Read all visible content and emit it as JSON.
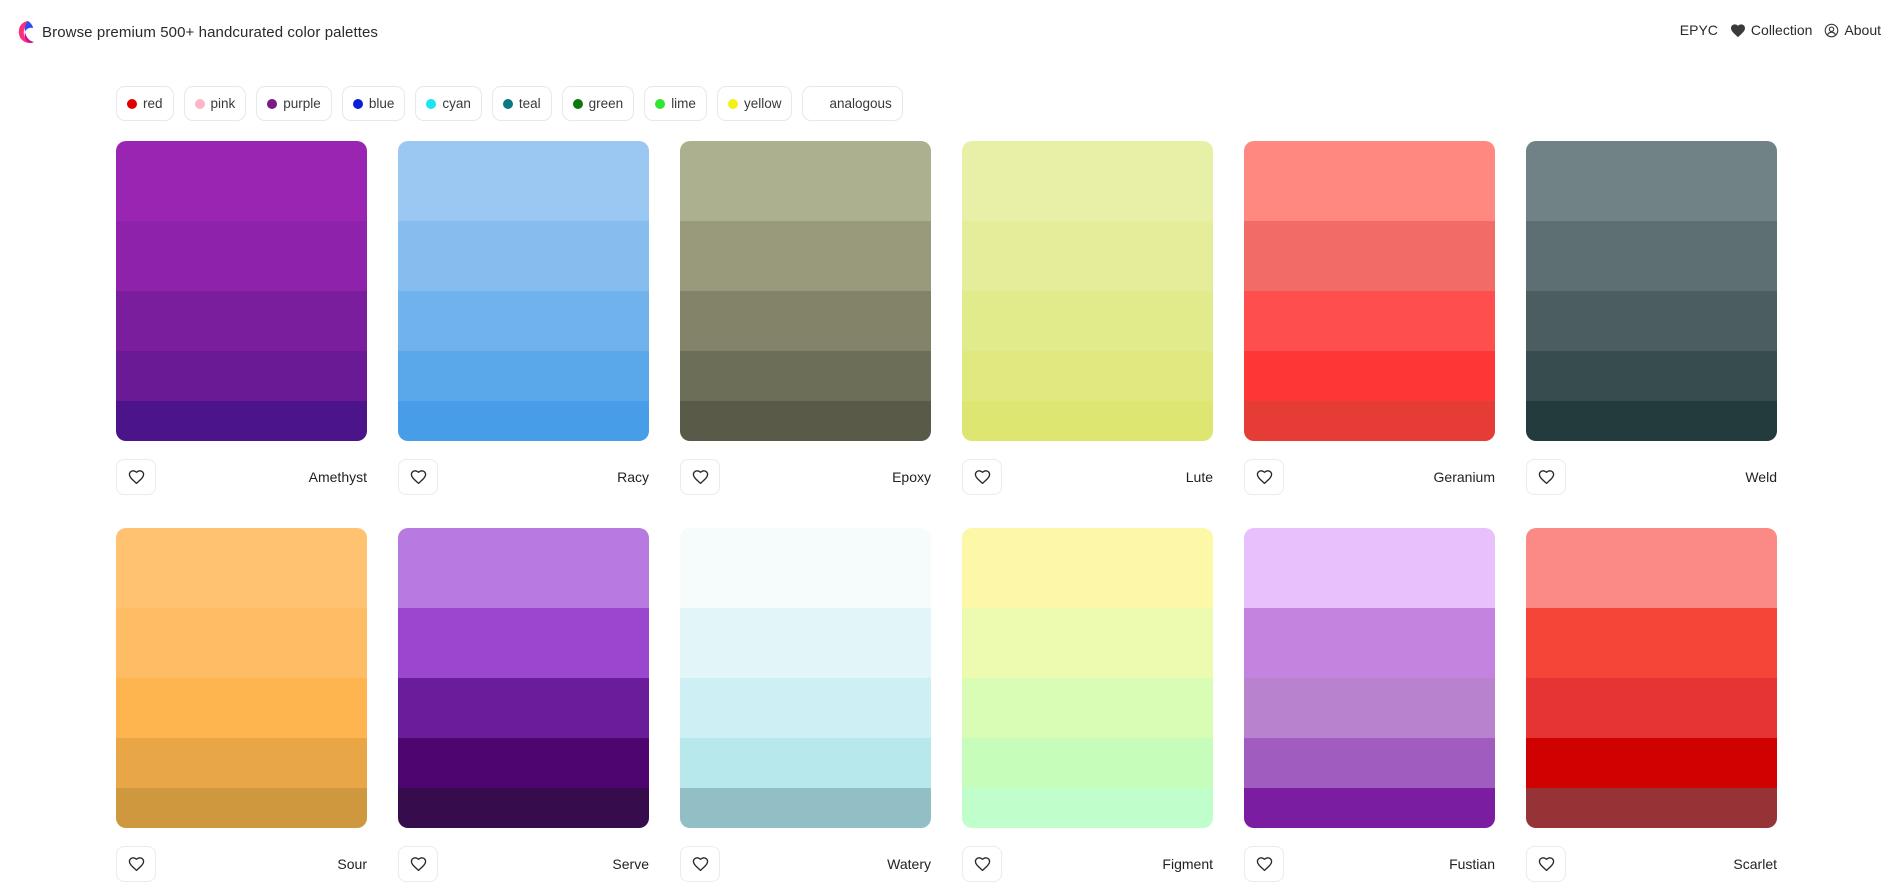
{
  "header": {
    "tagline": "Browse premium 500+ handcurated color palettes",
    "logo_colors": [
      "#ff2d7a",
      "#2a4df5"
    ],
    "nav": [
      {
        "label": "EPYC",
        "icon": ""
      },
      {
        "label": "Collection",
        "icon": "heart-icon"
      },
      {
        "label": "About",
        "icon": "user-circle-icon"
      }
    ]
  },
  "filters": [
    {
      "label": "red",
      "color": "#e00000"
    },
    {
      "label": "pink",
      "color": "#ffb6c8"
    },
    {
      "label": "purple",
      "color": "#7b1a82"
    },
    {
      "label": "blue",
      "color": "#0a1fd6"
    },
    {
      "label": "cyan",
      "color": "#19e6f0"
    },
    {
      "label": "teal",
      "color": "#0a7a80"
    },
    {
      "label": "green",
      "color": "#0a7a0a"
    },
    {
      "label": "lime",
      "color": "#2ee62e"
    },
    {
      "label": "yellow",
      "color": "#f4f01a"
    },
    {
      "label": "analogous",
      "color": ""
    }
  ],
  "palettes": [
    {
      "name": "Amethyst",
      "colors": [
        "#9b25b3",
        "#8e22aa",
        "#7b1e9e",
        "#6a1a95",
        "#4b1589"
      ]
    },
    {
      "name": "Racy",
      "colors": [
        "#9ac8f2",
        "#86bdef",
        "#70b2ec",
        "#5aa7ea",
        "#479de8"
      ]
    },
    {
      "name": "Epoxy",
      "colors": [
        "#adb08e",
        "#989a7b",
        "#828368",
        "#6d6e57",
        "#5a5a48"
      ]
    },
    {
      "name": "Lute",
      "colors": [
        "#e8f0a7",
        "#e5ed9a",
        "#e2eb8c",
        "#dfe97f",
        "#dce671"
      ]
    },
    {
      "name": "Geranium",
      "colors": [
        "#ff8881",
        "#f26c67",
        "#fe4e4e",
        "#fe3636",
        "#e63c36"
      ]
    },
    {
      "name": "Weld",
      "colors": [
        "#718286",
        "#5e6f73",
        "#4b5d5f",
        "#364c4e",
        "#233b3d"
      ]
    },
    {
      "name": "Sour",
      "colors": [
        "#fec270",
        "#febd65",
        "#feb54f",
        "#e8a646",
        "#d0983e"
      ]
    },
    {
      "name": "Serve",
      "colors": [
        "#b77ae0",
        "#9b46cf",
        "#6a1c9b",
        "#4e056f",
        "#360c4d"
      ]
    },
    {
      "name": "Watery",
      "colors": [
        "#f6fbfb",
        "#e2f5f7",
        "#ceeff3",
        "#b6e8ec",
        "#91bfc5"
      ]
    },
    {
      "name": "Figment",
      "colors": [
        "#fdf7a8",
        "#ecfbb0",
        "#d9fdb4",
        "#c6fdbb",
        "#c0fecc"
      ]
    },
    {
      "name": "Fustian",
      "colors": [
        "#e8c0fb",
        "#c483df",
        "#b882cf",
        "#a05cbf",
        "#7b1da0"
      ]
    },
    {
      "name": "Scarlet",
      "colors": [
        "#fb8a87",
        "#f54438",
        "#e63434",
        "#cf0101",
        "#953336"
      ]
    }
  ]
}
